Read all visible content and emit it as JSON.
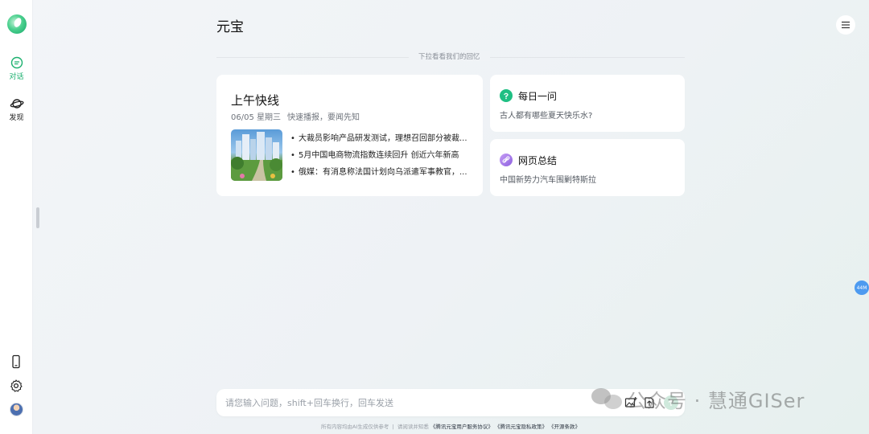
{
  "sidebar": {
    "items": [
      {
        "label": "对话",
        "icon": "chat-icon",
        "active": true
      },
      {
        "label": "发现",
        "icon": "planet-icon",
        "active": false
      }
    ],
    "bottom_icons": [
      "phone-icon",
      "gear-icon",
      "avatar"
    ]
  },
  "header": {
    "title": "元宝",
    "menu_icon": "hamburger-menu-icon"
  },
  "divider": {
    "text": "下拉看看我们的回忆"
  },
  "news_card": {
    "title": "上午快线",
    "date": "06/05 星期三",
    "slogan": "快速播报，要闻先知",
    "image": "city-park-photo",
    "items": [
      "大裁员影响产品研发测试，理想召回部分被裁...",
      "5月中国电商物流指数连续回升 创近六年新高",
      "俄媒：有消息称法国计划向乌派遣军事教官，..."
    ]
  },
  "daily_question": {
    "title": "每日一问",
    "subtitle": "古人都有哪些夏天快乐水?"
  },
  "web_summary": {
    "title": "网页总结",
    "subtitle": "中国新势力汽车围剿特斯拉"
  },
  "float_badge": {
    "label": "44M"
  },
  "composer": {
    "placeholder": "请您输入问题，shift+回车换行，回车发送",
    "value": ""
  },
  "footer": {
    "disclaimer": "所有内容均由AI生成仅供参考",
    "agree_prefix": "请阅读并知悉",
    "link1": "《腾讯元宝用户服务协议》",
    "link2": "《腾讯元宝隐私政策》",
    "link3": "《开源条款》"
  },
  "watermark": {
    "text": "公众号 · 慧通GISer"
  },
  "colors": {
    "accent": "#1bb06e",
    "daily_icon": "#1fbf83",
    "summary_icon": "#a57be8",
    "badge": "#4d9af0"
  }
}
